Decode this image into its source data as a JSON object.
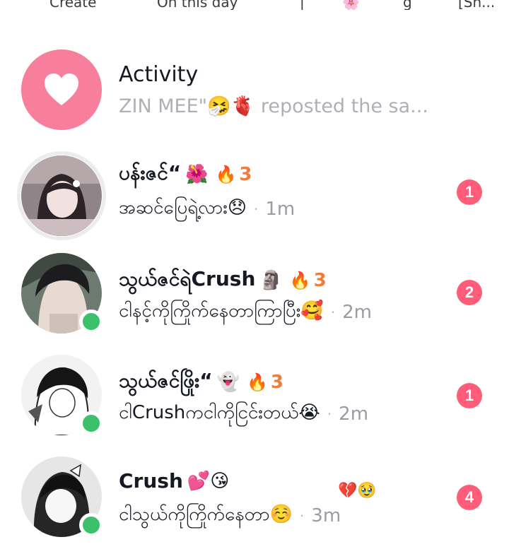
{
  "top_strip": {
    "items": [
      "Create",
      "On this day",
      "|",
      "🌸",
      "g",
      "[Sh..."
    ]
  },
  "activity": {
    "title": "Activity",
    "subtitle": "ZIN MEE\"🤧🫀 reposted the sa...",
    "icon": "heart-icon",
    "icon_bg": "#f77f9b"
  },
  "conversations": [
    {
      "name": "ပန်းဇင်“",
      "name_emoji": "🌺",
      "streak": "3",
      "message": "အဆင်ပြေရဲ့လား😞",
      "time": "1m",
      "unread": "1",
      "online": false,
      "story_ring": true
    },
    {
      "name": "သွယ်ဇင်ရဲCrush",
      "name_emoji": "🗿",
      "streak": "3",
      "message": "ငါနင့်ကိုကြိုက်နေတာကြာပြီး🥰",
      "time": "2m",
      "unread": "2",
      "online": true,
      "story_ring": false
    },
    {
      "name": "သွယ်ဇင်ဖြိုး“",
      "name_emoji": "👻",
      "streak": "3",
      "message": "ငါCrushကငါကိုငြင်းတယ်😭",
      "time": "2m",
      "unread": "1",
      "online": true,
      "story_ring": false
    },
    {
      "name": "Crush",
      "name_emoji": "💕😘",
      "streak": "",
      "message": "ငါသွယ်ကိုကြိုက်နေတာ☺️",
      "time": "3m",
      "unread": "4",
      "online": true,
      "story_ring": false,
      "floating_emoji": "💔🥹"
    }
  ],
  "colors": {
    "badge": "#fe5c78",
    "streak": "#f07c3d",
    "online": "#3cc06a",
    "muted": "#9a9ca3"
  },
  "streak_icon": "fire-icon",
  "separator": "·"
}
